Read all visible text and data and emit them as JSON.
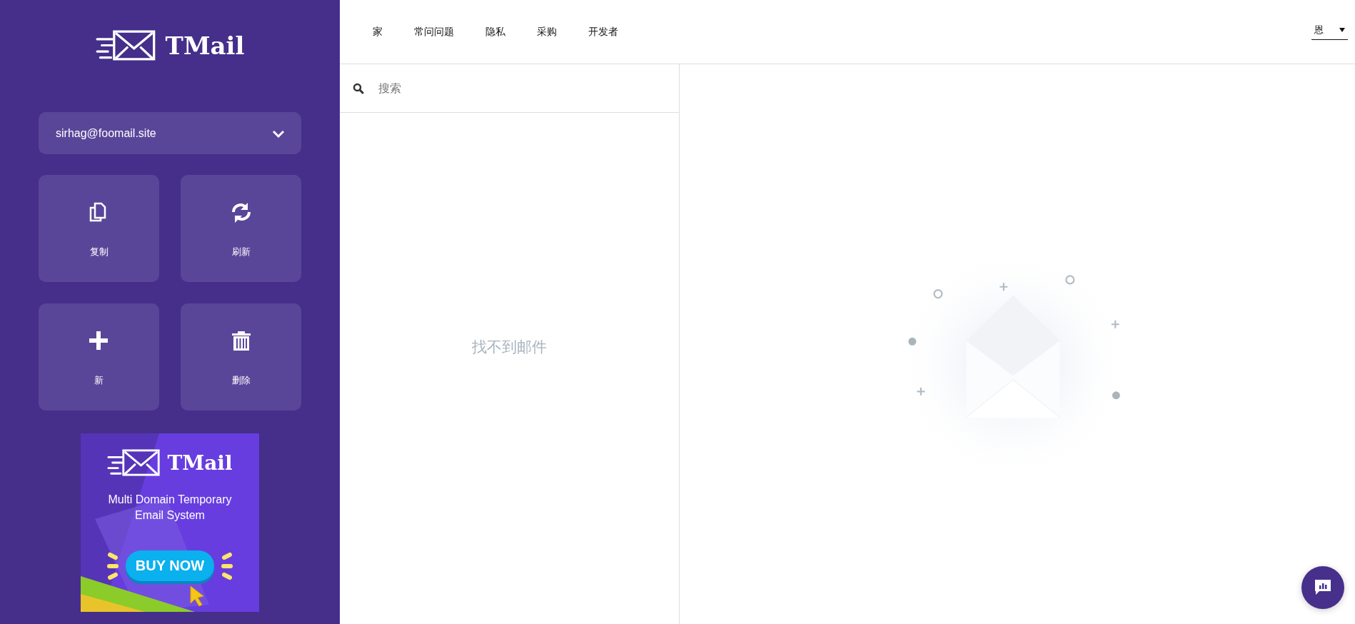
{
  "sidebar": {
    "logo": "TMail",
    "account": {
      "email": "sirhag@foomail.site"
    },
    "actions": [
      {
        "kind": "copy",
        "label": "复制"
      },
      {
        "kind": "refresh",
        "label": "刷新"
      },
      {
        "kind": "new",
        "label": "新"
      },
      {
        "kind": "delete",
        "label": "删除"
      }
    ],
    "banner": {
      "logo": "TMail",
      "tagline": "Multi Domain Temporary Email System",
      "button": "BUY NOW"
    }
  },
  "nav": {
    "links": [
      "家",
      "常问问题",
      "隐私",
      "采购",
      "开发者"
    ],
    "language": "恩"
  },
  "mail_list": {
    "search": {
      "placeholder": "搜索"
    },
    "empty_message": "找不到邮件"
  }
}
